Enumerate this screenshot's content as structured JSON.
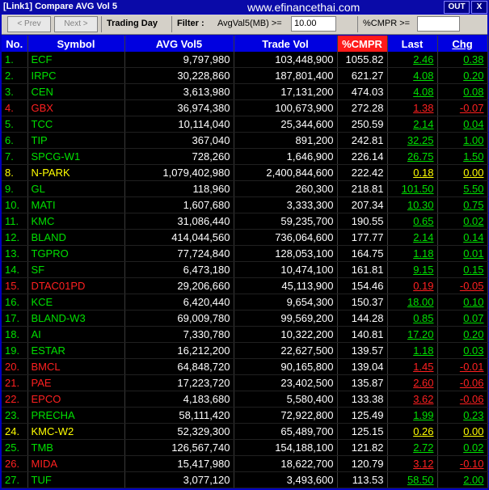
{
  "window": {
    "title": "[Link1] Compare AVG Vol 5",
    "watermark": "www.efinancethai.com",
    "out_label": "OUT",
    "close_label": "X"
  },
  "toolbar": {
    "prev_label": "< Prev",
    "next_label": "Next >",
    "trading_day_label": "Trading Day",
    "filter_label": "Filter :",
    "avgval_label": "AvgVal5(MB) >=",
    "avgval_value": "10.00",
    "cmpr_label": "%CMPR >=",
    "cmpr_value": ""
  },
  "table": {
    "headers": [
      "No.",
      "Symbol",
      "AVG Vol5",
      "Trade Vol",
      "%CMPR",
      "Last",
      "Chg"
    ],
    "rows": [
      {
        "no": "1.",
        "symbol": "ECF",
        "avg": "9,797,980",
        "vol": "103,448,900",
        "cmpr": "1055.82",
        "last": "2.46",
        "chg": "0.38",
        "status": "up"
      },
      {
        "no": "2.",
        "symbol": "IRPC",
        "avg": "30,228,860",
        "vol": "187,801,400",
        "cmpr": "621.27",
        "last": "4.08",
        "chg": "0.20",
        "status": "up"
      },
      {
        "no": "3.",
        "symbol": "CEN",
        "avg": "3,613,980",
        "vol": "17,131,200",
        "cmpr": "474.03",
        "last": "4.08",
        "chg": "0.08",
        "status": "up"
      },
      {
        "no": "4.",
        "symbol": "GBX",
        "avg": "36,974,380",
        "vol": "100,673,900",
        "cmpr": "272.28",
        "last": "1.38",
        "chg": "-0.07",
        "status": "down"
      },
      {
        "no": "5.",
        "symbol": "TCC",
        "avg": "10,114,040",
        "vol": "25,344,600",
        "cmpr": "250.59",
        "last": "2.14",
        "chg": "0.04",
        "status": "up"
      },
      {
        "no": "6.",
        "symbol": "TIP",
        "avg": "367,040",
        "vol": "891,200",
        "cmpr": "242.81",
        "last": "32.25",
        "chg": "1.00",
        "status": "up"
      },
      {
        "no": "7.",
        "symbol": "SPCG-W1",
        "avg": "728,260",
        "vol": "1,646,900",
        "cmpr": "226.14",
        "last": "26.75",
        "chg": "1.50",
        "status": "up"
      },
      {
        "no": "8.",
        "symbol": "N-PARK",
        "avg": "1,079,402,980",
        "vol": "2,400,844,600",
        "cmpr": "222.42",
        "last": "0.18",
        "chg": "0.00",
        "status": "flat"
      },
      {
        "no": "9.",
        "symbol": "GL",
        "avg": "118,960",
        "vol": "260,300",
        "cmpr": "218.81",
        "last": "101.50",
        "chg": "5.50",
        "status": "up"
      },
      {
        "no": "10.",
        "symbol": "MATI",
        "avg": "1,607,680",
        "vol": "3,333,300",
        "cmpr": "207.34",
        "last": "10.30",
        "chg": "0.75",
        "status": "up"
      },
      {
        "no": "11.",
        "symbol": "KMC",
        "avg": "31,086,440",
        "vol": "59,235,700",
        "cmpr": "190.55",
        "last": "0.65",
        "chg": "0.02",
        "status": "up"
      },
      {
        "no": "12.",
        "symbol": "BLAND",
        "avg": "414,044,560",
        "vol": "736,064,600",
        "cmpr": "177.77",
        "last": "2.14",
        "chg": "0.14",
        "status": "up"
      },
      {
        "no": "13.",
        "symbol": "TGPRO",
        "avg": "77,724,840",
        "vol": "128,053,100",
        "cmpr": "164.75",
        "last": "1.18",
        "chg": "0.01",
        "status": "up"
      },
      {
        "no": "14.",
        "symbol": "SF",
        "avg": "6,473,180",
        "vol": "10,474,100",
        "cmpr": "161.81",
        "last": "9.15",
        "chg": "0.15",
        "status": "up"
      },
      {
        "no": "15.",
        "symbol": "DTAC01PD",
        "avg": "29,206,660",
        "vol": "45,113,900",
        "cmpr": "154.46",
        "last": "0.19",
        "chg": "-0.05",
        "status": "down"
      },
      {
        "no": "16.",
        "symbol": "KCE",
        "avg": "6,420,440",
        "vol": "9,654,300",
        "cmpr": "150.37",
        "last": "18.00",
        "chg": "0.10",
        "status": "up"
      },
      {
        "no": "17.",
        "symbol": "BLAND-W3",
        "avg": "69,009,780",
        "vol": "99,569,200",
        "cmpr": "144.28",
        "last": "0.85",
        "chg": "0.07",
        "status": "up"
      },
      {
        "no": "18.",
        "symbol": "AI",
        "avg": "7,330,780",
        "vol": "10,322,200",
        "cmpr": "140.81",
        "last": "17.20",
        "chg": "0.20",
        "status": "up"
      },
      {
        "no": "19.",
        "symbol": "ESTAR",
        "avg": "16,212,200",
        "vol": "22,627,500",
        "cmpr": "139.57",
        "last": "1.18",
        "chg": "0.03",
        "status": "up"
      },
      {
        "no": "20.",
        "symbol": "BMCL",
        "avg": "64,848,720",
        "vol": "90,165,800",
        "cmpr": "139.04",
        "last": "1.45",
        "chg": "-0.01",
        "status": "down"
      },
      {
        "no": "21.",
        "symbol": "PAE",
        "avg": "17,223,720",
        "vol": "23,402,500",
        "cmpr": "135.87",
        "last": "2.60",
        "chg": "-0.06",
        "status": "down"
      },
      {
        "no": "22.",
        "symbol": "EPCO",
        "avg": "4,183,680",
        "vol": "5,580,400",
        "cmpr": "133.38",
        "last": "3.62",
        "chg": "-0.06",
        "status": "down"
      },
      {
        "no": "23.",
        "symbol": "PRECHA",
        "avg": "58,111,420",
        "vol": "72,922,800",
        "cmpr": "125.49",
        "last": "1.99",
        "chg": "0.23",
        "status": "up"
      },
      {
        "no": "24.",
        "symbol": "KMC-W2",
        "avg": "52,329,300",
        "vol": "65,489,700",
        "cmpr": "125.15",
        "last": "0.26",
        "chg": "0.00",
        "status": "flat"
      },
      {
        "no": "25.",
        "symbol": "TMB",
        "avg": "126,567,740",
        "vol": "154,188,100",
        "cmpr": "121.82",
        "last": "2.72",
        "chg": "0.02",
        "status": "up"
      },
      {
        "no": "26.",
        "symbol": "MIDA",
        "avg": "15,417,980",
        "vol": "18,622,700",
        "cmpr": "120.79",
        "last": "3.12",
        "chg": "-0.10",
        "status": "down"
      },
      {
        "no": "27.",
        "symbol": "TUF",
        "avg": "3,077,120",
        "vol": "3,493,600",
        "cmpr": "113.53",
        "last": "58.50",
        "chg": "2.00",
        "status": "up"
      }
    ]
  },
  "colors": {
    "up": "#00e000",
    "down": "#ff2020",
    "flat": "#ffff00",
    "header": "#0000e0",
    "cmpr_header": "#ff1a1a"
  }
}
